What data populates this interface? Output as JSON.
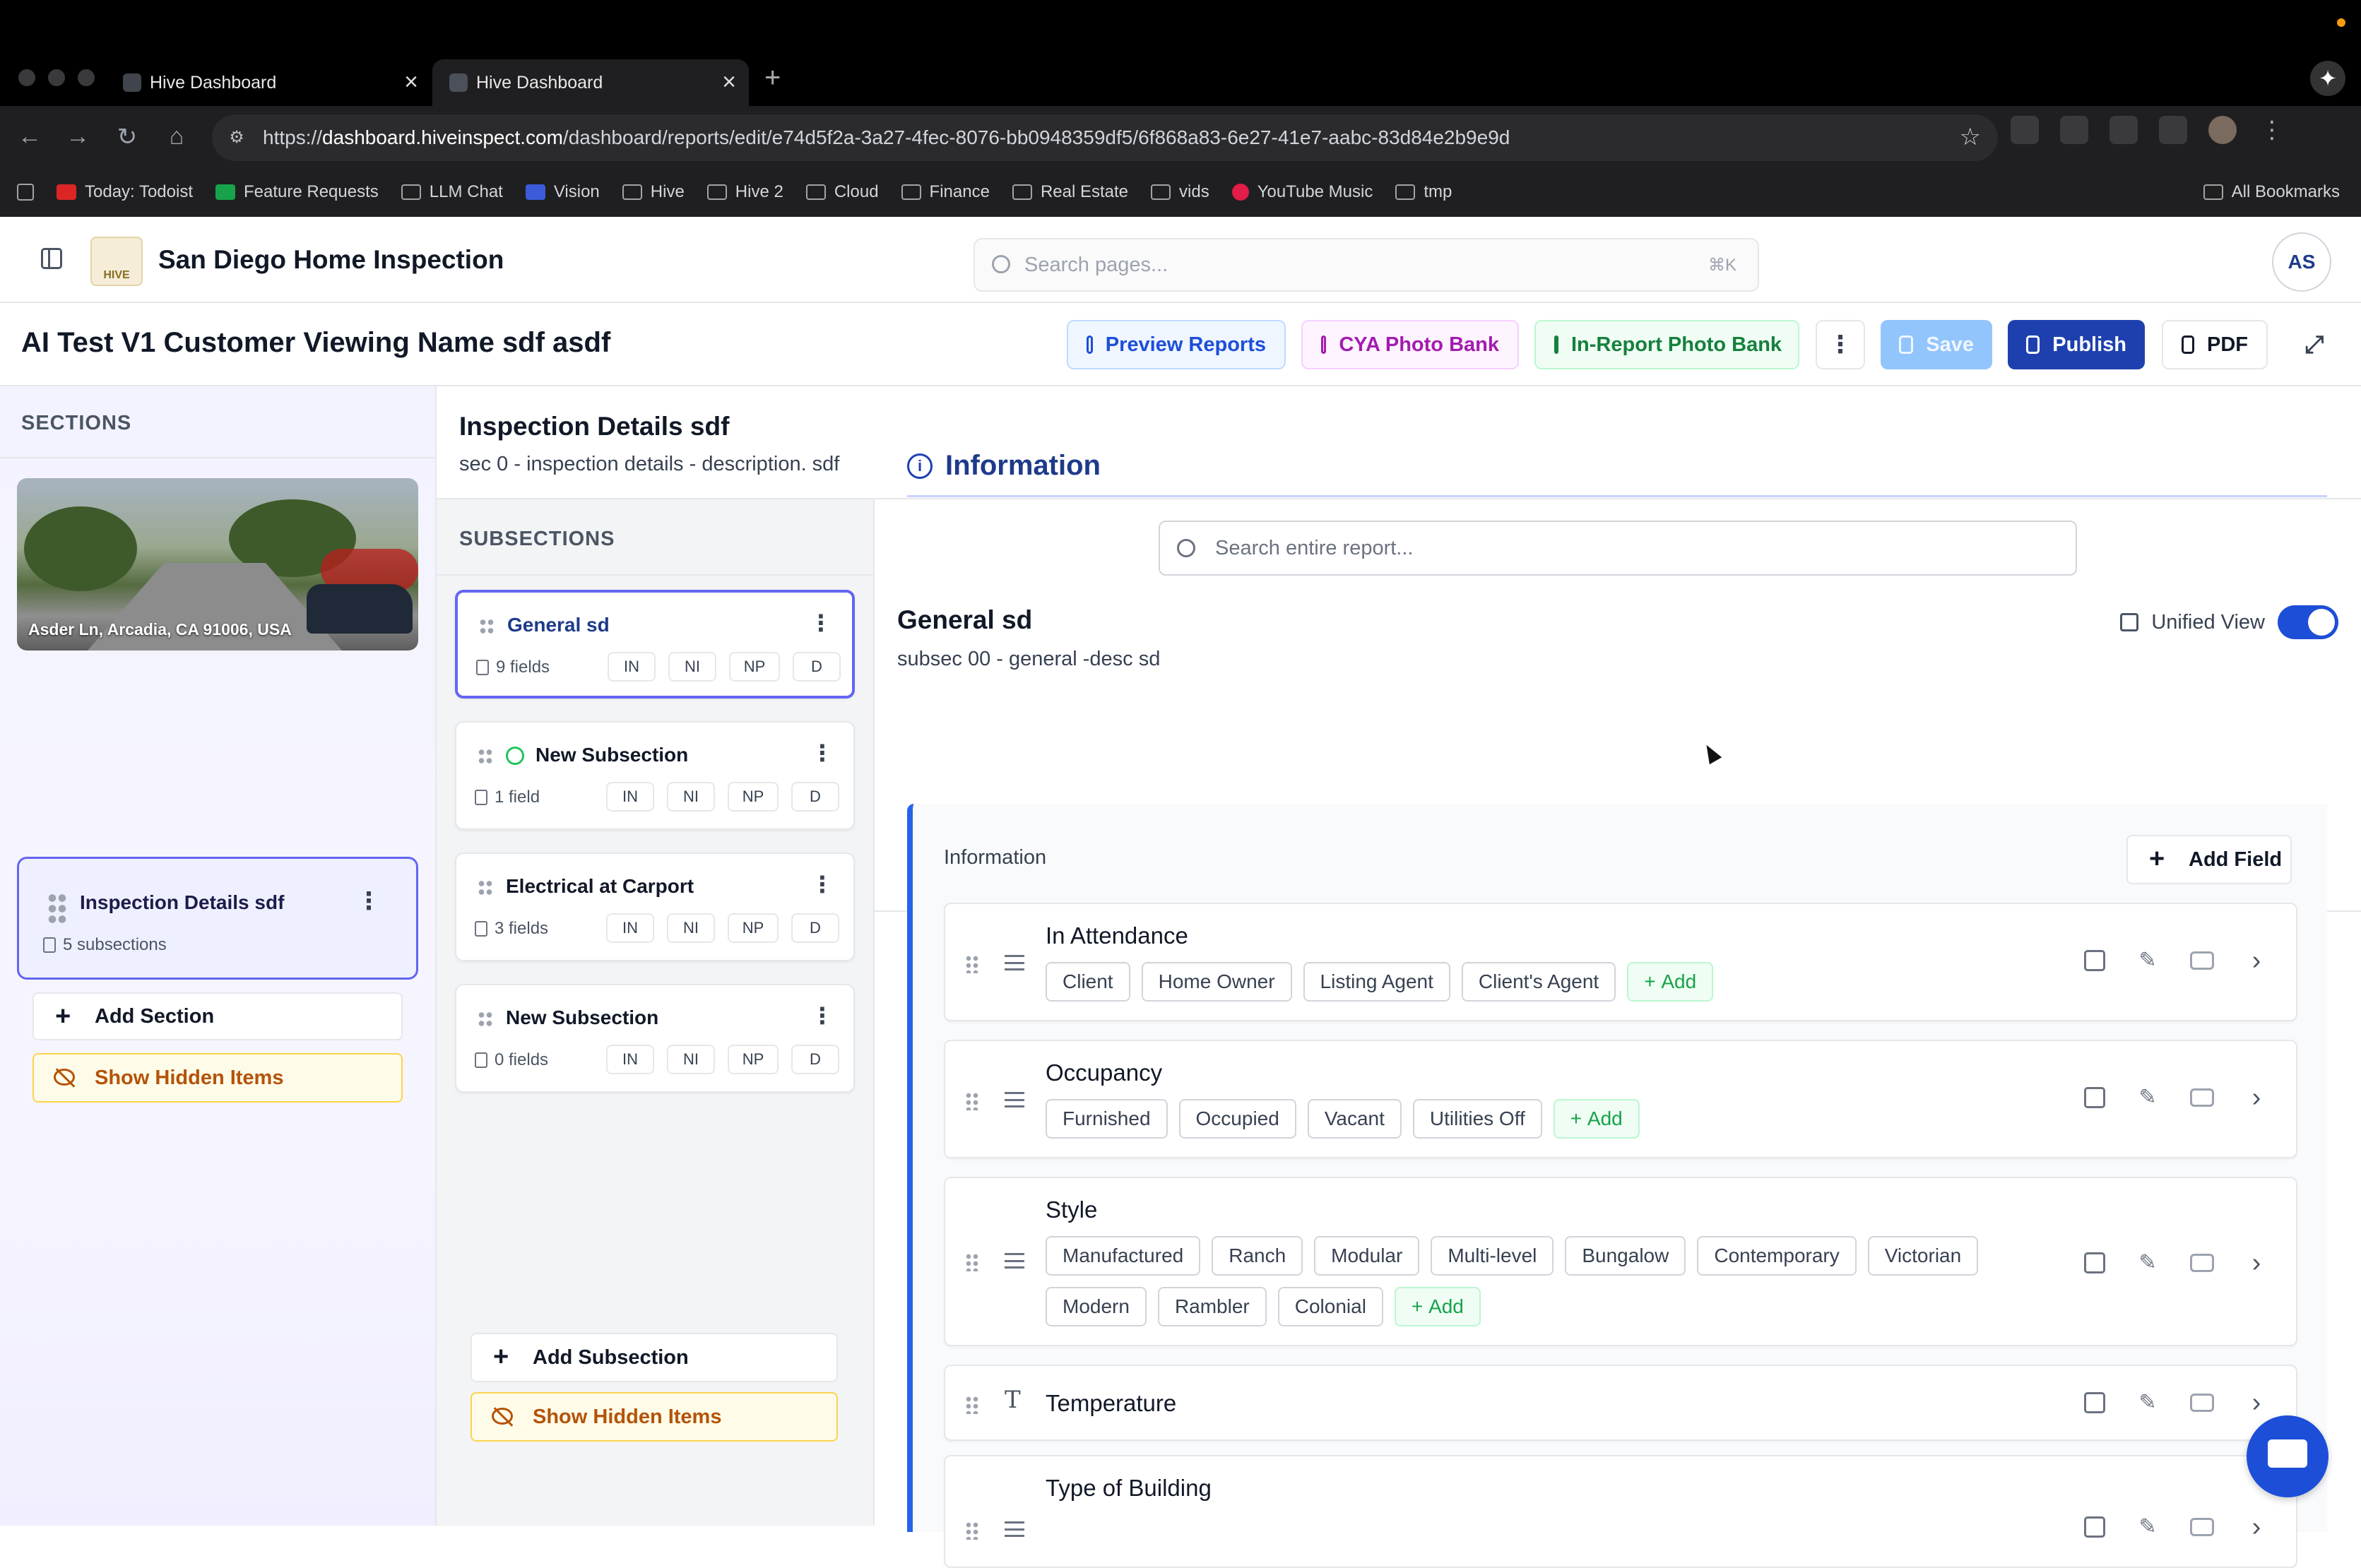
{
  "browser": {
    "tabs": [
      {
        "title": "Hive Dashboard"
      },
      {
        "title": "Hive Dashboard"
      }
    ],
    "url_prefix": "https://",
    "url_host": "dashboard.hiveinspect.com",
    "url_path": "/dashboard/reports/edit/e74d5f2a-3a27-4fec-8076-bb0948359df5/6f868a83-6e27-41e7-aabc-83d84e2b9e9d",
    "bookmarks": [
      {
        "label": "Today: Todoist",
        "icon": "todoist-icon"
      },
      {
        "label": "Feature Requests",
        "icon": "sheet-icon"
      },
      {
        "label": "LLM Chat",
        "icon": "folder-icon"
      },
      {
        "label": "Vision",
        "icon": "doc-icon"
      },
      {
        "label": "Hive",
        "icon": "folder-icon"
      },
      {
        "label": "Hive 2",
        "icon": "folder-icon"
      },
      {
        "label": "Cloud",
        "icon": "folder-icon"
      },
      {
        "label": "Finance",
        "icon": "folder-icon"
      },
      {
        "label": "Real Estate",
        "icon": "folder-icon"
      },
      {
        "label": "vids",
        "icon": "folder-icon"
      },
      {
        "label": "YouTube Music",
        "icon": "youtube-music-icon"
      },
      {
        "label": "tmp",
        "icon": "folder-icon"
      }
    ],
    "all_bookmarks": "All Bookmarks"
  },
  "header": {
    "company": "San Diego Home Inspection",
    "logo_text": "HIVE",
    "search_placeholder": "Search pages...",
    "search_shortcut": "⌘K",
    "user_initials": "AS"
  },
  "toolbar": {
    "report_title": "AI Test V1 Customer Viewing Name sdf asdf",
    "preview": "Preview Reports",
    "cya": "CYA Photo Bank",
    "in_report": "In-Report Photo Bank",
    "save": "Save",
    "publish": "Publish",
    "pdf": "PDF"
  },
  "sections_panel": {
    "heading": "SECTIONS",
    "photo_address": "Asder Ln, Arcadia, CA 91006, USA",
    "section": {
      "name": "Inspection Details sdf",
      "meta": "5 subsections"
    },
    "add_section": "Add Section",
    "show_hidden": "Show Hidden Items"
  },
  "section_header": {
    "title": "Inspection Details sdf",
    "description": "sec 0 - inspection details - description. sdf"
  },
  "subsections_panel": {
    "heading": "SUBSECTIONS",
    "items": [
      {
        "name": "General sd",
        "fields": "9 fields",
        "active": true
      },
      {
        "name": "New Subsection",
        "fields": "1 field",
        "active": false,
        "completed": true
      },
      {
        "name": "Electrical at Carport",
        "fields": "3 fields",
        "active": false
      },
      {
        "name": "New Subsection",
        "fields": "0 fields",
        "active": false
      }
    ],
    "pills": [
      "IN",
      "NI",
      "NP",
      "D"
    ],
    "add_subsection": "Add Subsection",
    "show_hidden": "Show Hidden Items"
  },
  "main": {
    "search_placeholder": "Search entire report...",
    "subsection_title": "General sd",
    "subsection_desc": "subsec 00 - general -desc sd",
    "unified_view": "Unified View",
    "unified_on": true,
    "info_heading": "Information",
    "group_title": "Information",
    "add_field": "Add Field",
    "add_chip": "Add",
    "fields": [
      {
        "name": "In Attendance",
        "type": "list",
        "options": [
          "Client",
          "Home Owner",
          "Listing Agent",
          "Client's Agent"
        ]
      },
      {
        "name": "Occupancy",
        "type": "list",
        "options": [
          "Furnished",
          "Occupied",
          "Vacant",
          "Utilities Off"
        ]
      },
      {
        "name": "Style",
        "type": "list",
        "options": [
          "Manufactured",
          "Ranch",
          "Modular",
          "Multi-level",
          "Bungalow",
          "Contemporary",
          "Victorian",
          "Modern",
          "Rambler",
          "Colonial"
        ]
      },
      {
        "name": "Temperature",
        "type": "text",
        "options": []
      },
      {
        "name": "Type of Building",
        "type": "list",
        "options": []
      }
    ]
  },
  "colors": {
    "primary": "#1e40af",
    "section_active_border": "#6366f1",
    "hidden_items_bg": "#fefce8",
    "add_chip_green": "#16a34a"
  }
}
